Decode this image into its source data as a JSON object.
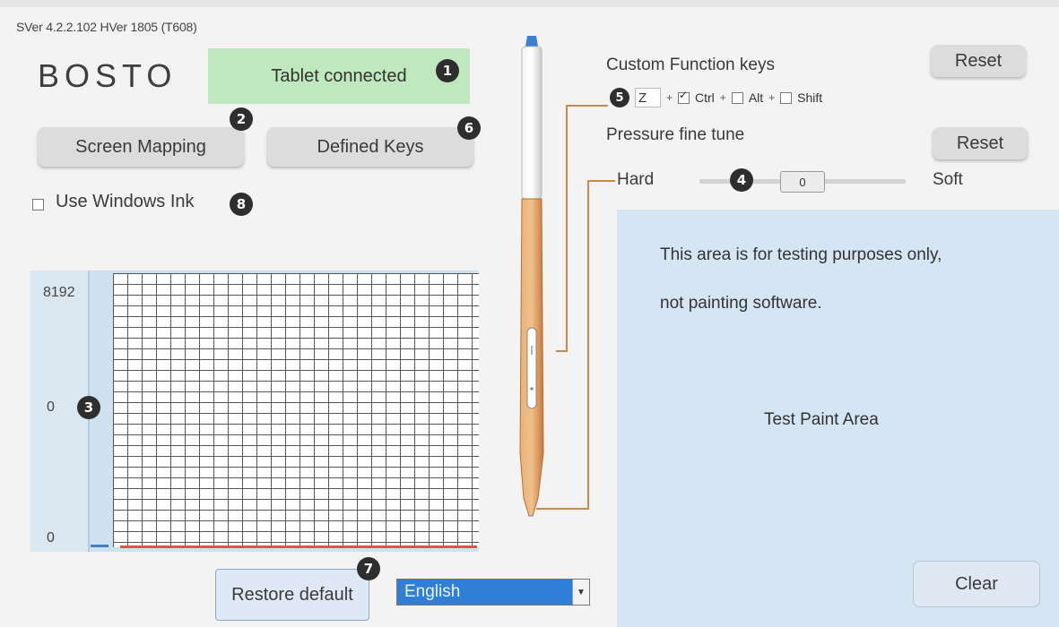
{
  "header": {
    "version": "SVer 4.2.2.102  HVer 1805  (T608)",
    "logo": "BOSTO"
  },
  "status": {
    "text": "Tablet connected",
    "color": "#bfe8bf"
  },
  "buttons": {
    "screen_mapping": "Screen Mapping",
    "defined_keys": "Defined Keys",
    "restore_default": "Restore default",
    "reset_function": "Reset",
    "reset_pressure": "Reset",
    "clear": "Clear"
  },
  "badges": {
    "b1": "1",
    "b2": "2",
    "b3": "3",
    "b4": "4",
    "b5": "5",
    "b6": "6",
    "b7": "7",
    "b8": "8"
  },
  "windows_ink": {
    "label": "Use Windows Ink",
    "checked": false
  },
  "pressure_graph": {
    "labels": [
      "8192",
      "0",
      "0"
    ],
    "current_value": 0,
    "line_color": "#e0554a"
  },
  "function_keys": {
    "title": "Custom Function keys",
    "key_value": "Z",
    "ctrl": {
      "label": "Ctrl",
      "checked": true
    },
    "alt": {
      "label": "Alt",
      "checked": false
    },
    "shift": {
      "label": "Shift",
      "checked": false
    }
  },
  "pressure_tune": {
    "title": "Pressure fine tune",
    "hard_label": "Hard",
    "soft_label": "Soft",
    "value": "0"
  },
  "test_area": {
    "line1": "This area is for testing purposes only,",
    "line2": "not painting software.",
    "title": "Test Paint Area",
    "background": "#d5e5f3"
  },
  "language": {
    "selected": "English"
  },
  "colors": {
    "accent_pen": "#e09a5a",
    "selection_blue": "#2f7fd6",
    "badge": "#2e2e2e"
  }
}
